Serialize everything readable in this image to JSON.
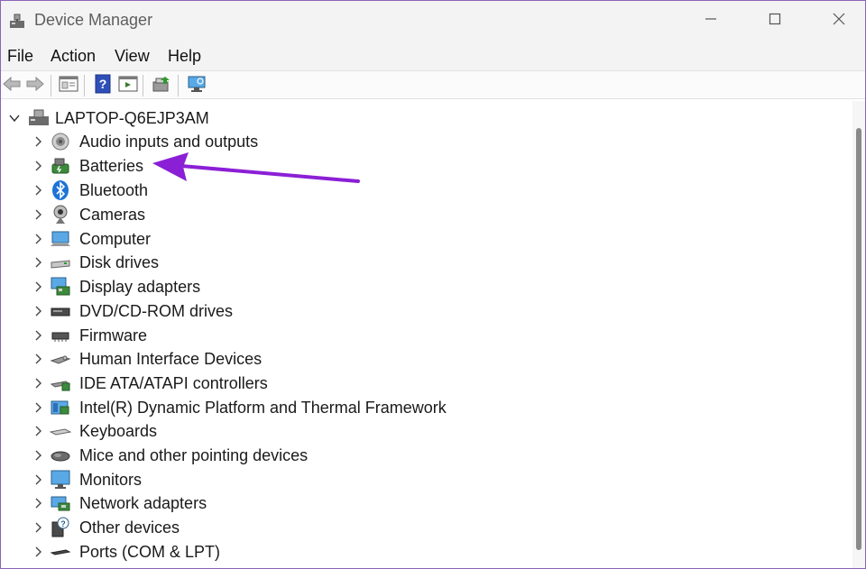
{
  "window": {
    "title": "Device Manager",
    "accent_arrow_color": "#8b1fd6"
  },
  "titlebar": {
    "app_icon": "device-manager-icon",
    "minimize_icon": "minimize-icon",
    "maximize_icon": "maximize-icon",
    "close_icon": "close-icon"
  },
  "menu": {
    "file": "File",
    "action": "Action",
    "view": "View",
    "help": "Help"
  },
  "toolbar": {
    "buttons": [
      "back-icon",
      "forward-icon",
      "properties-icon",
      "help-icon",
      "run-icon",
      "update-driver-icon",
      "scan-hardware-icon"
    ]
  },
  "tree": {
    "root_label": "LAPTOP-Q6EJP3AM",
    "categories": [
      {
        "label": "Audio inputs and outputs",
        "icon": "speaker-icon"
      },
      {
        "label": "Batteries",
        "icon": "battery-icon"
      },
      {
        "label": "Bluetooth",
        "icon": "bluetooth-icon"
      },
      {
        "label": "Cameras",
        "icon": "camera-icon"
      },
      {
        "label": "Computer",
        "icon": "computer-icon"
      },
      {
        "label": "Disk drives",
        "icon": "disk-drive-icon"
      },
      {
        "label": "Display adapters",
        "icon": "display-adapter-icon"
      },
      {
        "label": "DVD/CD-ROM drives",
        "icon": "dvd-drive-icon"
      },
      {
        "label": "Firmware",
        "icon": "firmware-icon"
      },
      {
        "label": "Human Interface Devices",
        "icon": "hid-icon"
      },
      {
        "label": "IDE ATA/ATAPI controllers",
        "icon": "ide-controller-icon"
      },
      {
        "label": "Intel(R) Dynamic Platform and Thermal Framework",
        "icon": "thermal-framework-icon"
      },
      {
        "label": "Keyboards",
        "icon": "keyboard-icon"
      },
      {
        "label": "Mice and other pointing devices",
        "icon": "mouse-icon"
      },
      {
        "label": "Monitors",
        "icon": "monitor-icon"
      },
      {
        "label": "Network adapters",
        "icon": "network-adapter-icon"
      },
      {
        "label": "Other devices",
        "icon": "other-devices-icon"
      },
      {
        "label": "Ports (COM & LPT)",
        "icon": "ports-icon"
      }
    ]
  }
}
